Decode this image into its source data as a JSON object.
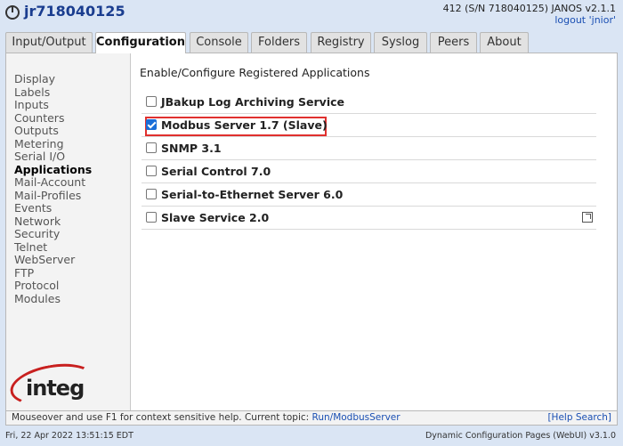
{
  "header": {
    "icon": "power-icon",
    "host": "jr718040125",
    "sysinfo": "412 (S/N 718040125) JANOS v2.1.1",
    "logout": "logout 'jnior'"
  },
  "tabs": [
    {
      "label": "Input/Output"
    },
    {
      "label": "Configuration",
      "active": true
    },
    {
      "label": "Console"
    },
    {
      "label": "Folders"
    },
    {
      "label": "Registry"
    },
    {
      "label": "Syslog"
    },
    {
      "label": "Peers"
    },
    {
      "label": "About"
    }
  ],
  "sidebar": {
    "items": [
      {
        "label": "Display"
      },
      {
        "label": "Labels"
      },
      {
        "label": "Inputs"
      },
      {
        "label": "Counters"
      },
      {
        "label": "Outputs"
      },
      {
        "label": "Metering"
      },
      {
        "label": "Serial I/O"
      },
      {
        "label": "Applications",
        "active": true
      },
      {
        "label": "Mail-Account"
      },
      {
        "label": "Mail-Profiles"
      },
      {
        "label": "Events"
      },
      {
        "label": "Network"
      },
      {
        "label": "Security"
      },
      {
        "label": "Telnet"
      },
      {
        "label": "WebServer"
      },
      {
        "label": "FTP"
      },
      {
        "label": "Protocol"
      },
      {
        "label": "Modules"
      }
    ],
    "brand": "integ"
  },
  "content": {
    "title": "Enable/Configure Registered Applications",
    "apps": [
      {
        "label": "JBakup Log Archiving Service",
        "checked": false
      },
      {
        "label": "Modbus Server 1.7 (Slave)",
        "checked": true,
        "highlighted": true
      },
      {
        "label": "SNMP 3.1",
        "checked": false
      },
      {
        "label": "Serial Control 7.0",
        "checked": false
      },
      {
        "label": "Serial-to-Ethernet Server 6.0",
        "checked": false
      },
      {
        "label": "Slave Service 2.0",
        "checked": false,
        "popout": "popout-icon"
      }
    ]
  },
  "status": {
    "help": "Mouseover and use F1 for context sensitive help. Current topic:",
    "topic": "Run/ModbusServer",
    "search": "[Help Search]"
  },
  "footer": {
    "date": "Fri, 22 Apr 2022 13:51:15 EDT",
    "version": "Dynamic Configuration Pages (WebUI) v3.1.0"
  },
  "colors": {
    "accent": "#1a3d8f",
    "link": "#1a4fb3",
    "highlight": "#e0302e",
    "brand_red": "#c8201f",
    "background": "#dae5f4"
  }
}
